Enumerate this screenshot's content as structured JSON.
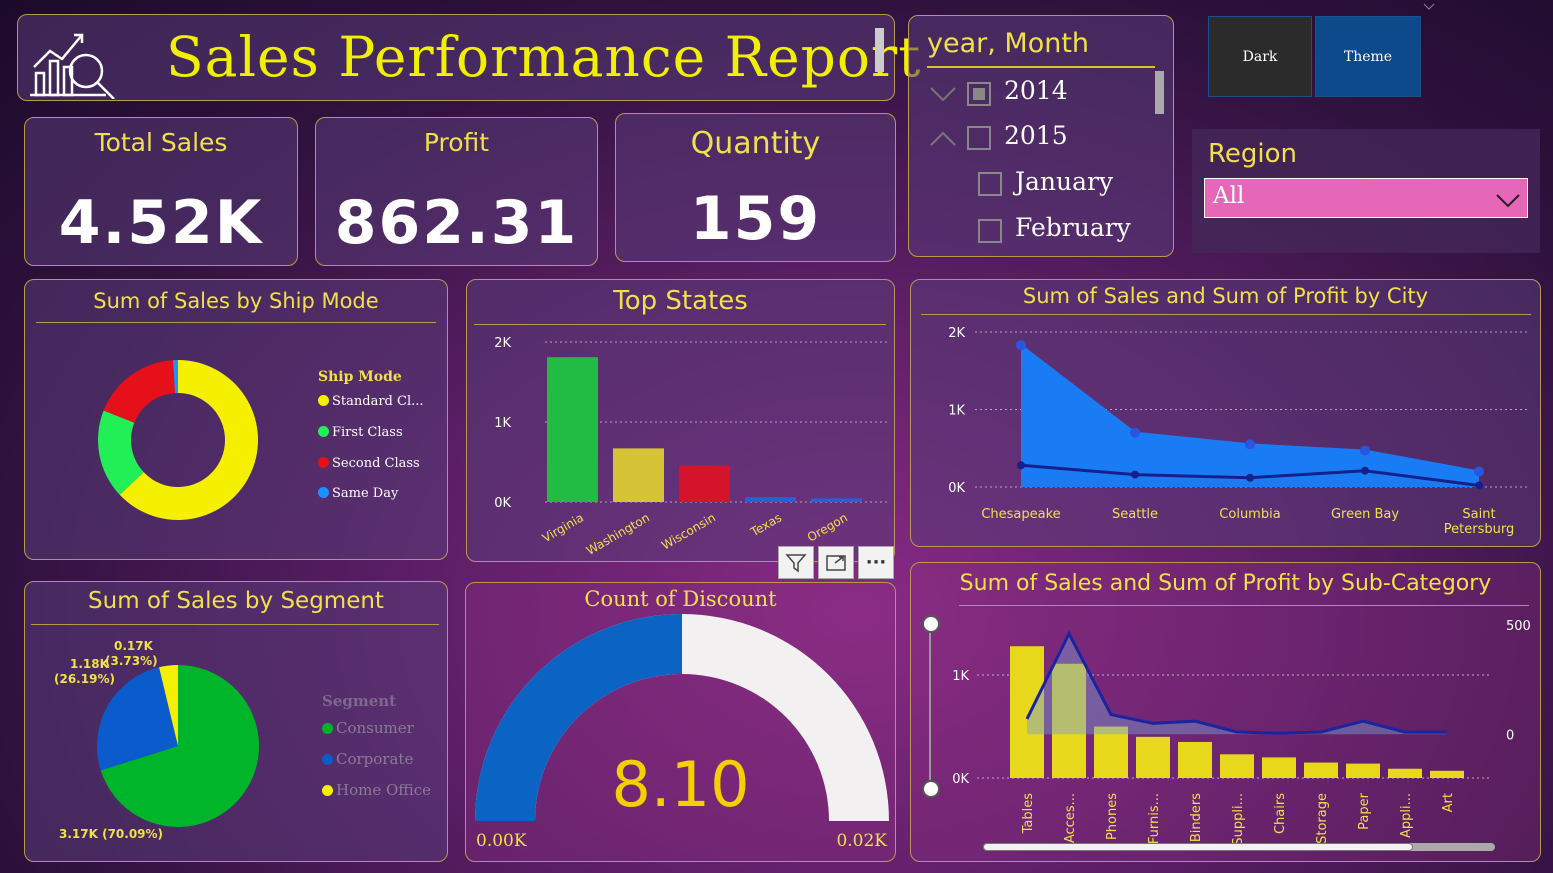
{
  "header": {
    "title": "Sales Performance Report"
  },
  "kpis": [
    {
      "label": "Total Sales",
      "value": "4.52K"
    },
    {
      "label": "Profit",
      "value": "862.31"
    },
    {
      "label": "Quantity",
      "value": "159"
    }
  ],
  "date_slicer": {
    "title": "year, Month",
    "items": [
      "2014",
      "2015",
      "January",
      "February"
    ]
  },
  "theme_buttons": {
    "dark": "Dark",
    "theme": "Theme"
  },
  "region": {
    "title": "Region",
    "selected": "All"
  },
  "ship_mode": {
    "title": "Sum of Sales by Ship Mode",
    "legend_title": "Ship Mode",
    "legend": [
      "Standard Cl...",
      "First Class",
      "Second Class",
      "Same Day"
    ],
    "colors": [
      "#f5f000",
      "#22ee55",
      "#e5101a",
      "#1e90ff"
    ]
  },
  "top_states": {
    "title": "Top States"
  },
  "city": {
    "title": "Sum of Sales and Sum of Profit by City"
  },
  "segment": {
    "title": "Sum of Sales by Segment",
    "legend_title": "Segment",
    "legend": [
      "Consumer",
      "Corporate",
      "Home Office"
    ],
    "colors": [
      "#00b52a",
      "#0a5ccc",
      "#f5f000"
    ],
    "labels": [
      "0.17K",
      "(3.73%)",
      "1.18K",
      "(26.19%)",
      "3.17K (70.09%)"
    ]
  },
  "discount": {
    "title": "Count of Discount",
    "value": "8.10",
    "min_label": "0.00K",
    "max_label": "0.02K",
    "fraction": 0.5
  },
  "subcat": {
    "title": "Sum of Sales and Sum of Profit by Sub-Category"
  },
  "chart_data": [
    {
      "type": "pie",
      "title": "Sum of Sales by Ship Mode",
      "categories": [
        "Standard Cl...",
        "First Class",
        "Second Class",
        "Same Day"
      ],
      "values": [
        63,
        18,
        18,
        1
      ]
    },
    {
      "type": "bar",
      "title": "Top States",
      "categories": [
        "Virginia",
        "Washington",
        "Wisconsin",
        "Texas",
        "Oregon"
      ],
      "values": [
        1810,
        670,
        455,
        60,
        45
      ],
      "colors": [
        "#22bb44",
        "#d6c436",
        "#d4142a",
        "#1e66d6",
        "#1e66d6"
      ],
      "yticks": [
        "0K",
        "1K",
        "2K"
      ],
      "ylim": [
        0,
        2000
      ]
    },
    {
      "type": "area",
      "title": "Sum of Sales and Sum of Profit by City",
      "categories": [
        "Chesapeake",
        "Seattle",
        "Columbia",
        "Green Bay",
        "Saint Petersburg"
      ],
      "series": [
        {
          "name": "Sum of Sales",
          "values": [
            1830,
            700,
            550,
            470,
            200
          ]
        },
        {
          "name": "Sum of Profit",
          "values": [
            280,
            160,
            120,
            210,
            20
          ]
        }
      ],
      "yticks": [
        "0K",
        "1K",
        "2K"
      ],
      "ylim": [
        0,
        2000
      ]
    },
    {
      "type": "pie",
      "title": "Sum of Sales by Segment",
      "categories": [
        "Consumer",
        "Corporate",
        "Home Office"
      ],
      "values": [
        3.17,
        1.18,
        0.17
      ]
    },
    {
      "type": "bar",
      "title": "Sum of Sales and Sum of Profit by Sub-Category",
      "categories": [
        "Tables",
        "Acces...",
        "Phones",
        "Furnis...",
        "Binders",
        "Suppli...",
        "Chairs",
        "Storage",
        "Paper",
        "Appli...",
        "Art"
      ],
      "series": [
        {
          "name": "Sum of Sales",
          "values": [
            1280,
            1110,
            500,
            400,
            350,
            230,
            200,
            150,
            140,
            90,
            70
          ]
        },
        {
          "name": "Sum of Profit",
          "values": [
            70,
            460,
            90,
            50,
            60,
            10,
            5,
            10,
            60,
            10,
            10
          ]
        }
      ],
      "yticks_left": [
        "0K",
        "1K"
      ],
      "yticks_right": [
        "0",
        "500"
      ],
      "ylim_left": [
        0,
        1700
      ],
      "ylim_right": [
        -200,
        600
      ]
    }
  ]
}
